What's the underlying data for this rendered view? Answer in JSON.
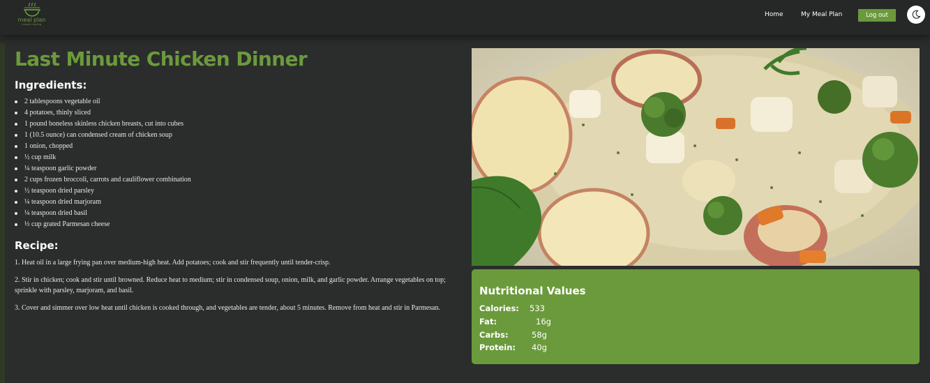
{
  "brand": {
    "name": "meal plan",
    "tagline": "simple eating"
  },
  "nav": {
    "home_label": "Home",
    "meal_plan_label": "My Meal Plan",
    "logout_label": "Log out",
    "theme_toggle_icon": "moon-icon"
  },
  "colors": {
    "accent": "#6b9a3c",
    "background": "#2b2d2c",
    "navbar": "#262827"
  },
  "recipe": {
    "title": "Last Minute Chicken Dinner",
    "ingredients_heading": "Ingredients:",
    "ingredients": [
      "2 tablespoons vegetable oil",
      "4 potatoes, thinly sliced",
      "1 pound boneless skinless chicken breasts, cut into cubes",
      "1 (10.5 ounce) can condensed cream of chicken soup",
      "1 onion, chopped",
      "½ cup milk",
      "¼ teaspoon garlic powder",
      "2 cups frozen broccoli, carrots and cauliflower combination",
      "½ teaspoon dried parsley",
      "¼ teaspoon dried marjoram",
      "¼ teaspoon dried basil",
      "⅓ cup grated Parmesan cheese"
    ],
    "recipe_heading": "Recipe:",
    "steps": [
      "1. Heat oil in a large frying pan over medium-high heat. Add potatoes; cook and stir frequently until tender-crisp.",
      "2. Stir in chicken; cook and stir until browned. Reduce heat to medium; stir in condensed soup, onion, milk, and garlic powder. Arrange vegetables on top; sprinkle with parsley, marjoram, and basil.",
      "3. Cover and simmer over low heat until chicken is cooked through, and vegetables are tender, about 5 minutes. Remove from heat and stir in Parmesan."
    ]
  },
  "nutrition": {
    "heading": "Nutritional Values",
    "items": [
      {
        "label": "Calories:",
        "value": "533"
      },
      {
        "label": "Fat:",
        "value": "16g"
      },
      {
        "label": "Carbs:",
        "value": "58g"
      },
      {
        "label": "Protein:",
        "value": "40g"
      }
    ]
  }
}
